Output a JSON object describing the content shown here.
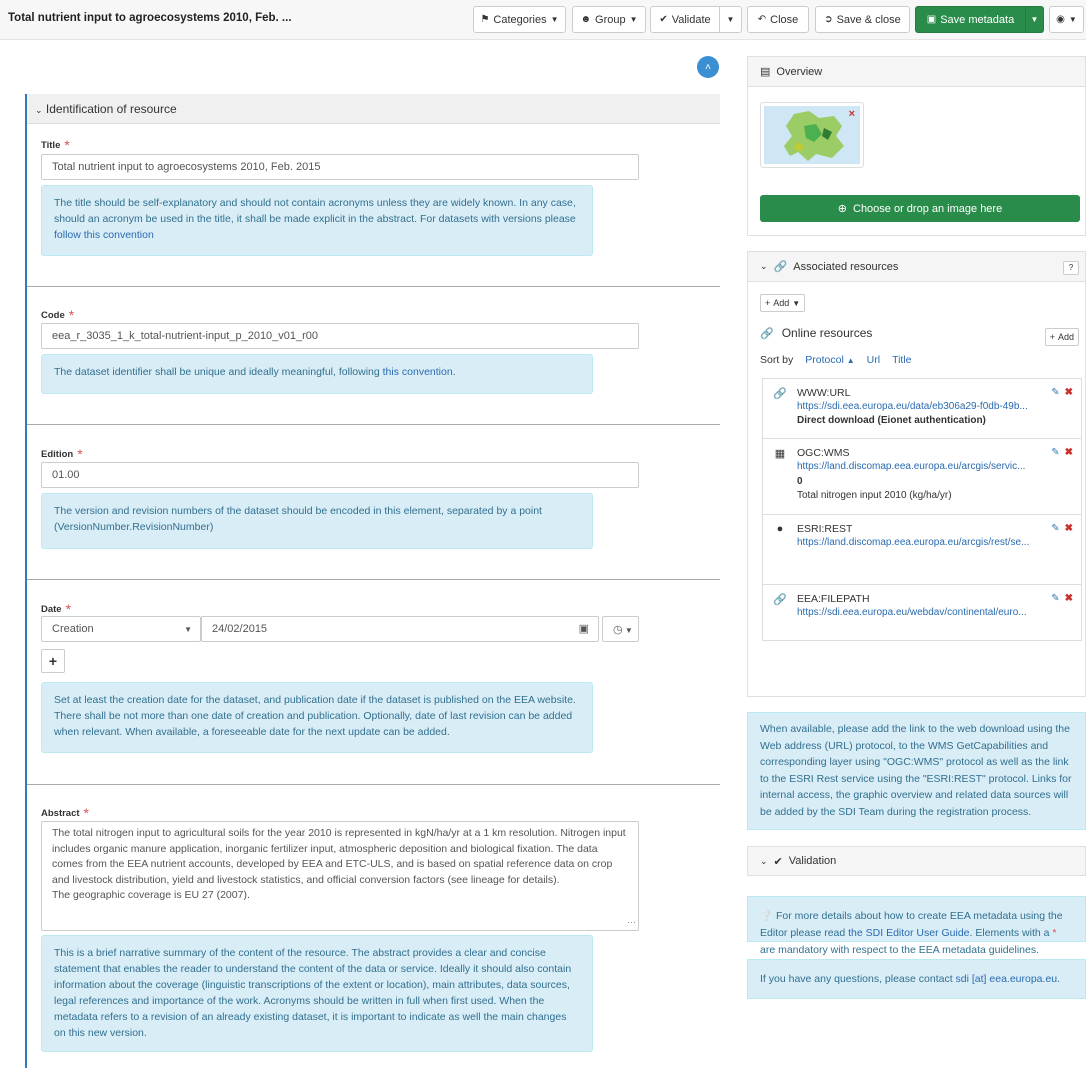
{
  "header": {
    "title": "Total nutrient input to agroecosystems 2010, Feb. ...",
    "categories_label": "Categories",
    "group_label": "Group",
    "validate_label": "Validate",
    "close_label": "Close",
    "save_close_label": "Save & close",
    "save_metadata_label": "Save metadata"
  },
  "section": {
    "title": "Identification of resource"
  },
  "title_field": {
    "label": "Title",
    "value": "Total nutrient input to agroecosystems 2010, Feb. 2015",
    "help_text": "The title should be self-explanatory and should not contain acronyms unless they are widely known. In any case, should an acronym be used in the title, it shall be made explicit in the abstract. For datasets with versions please ",
    "help_link": "follow this convention"
  },
  "code_field": {
    "label": "Code",
    "value": "eea_r_3035_1_k_total-nutrient-input_p_2010_v01_r00",
    "help_text": "The dataset identifier shall be unique and ideally meaningful, following ",
    "help_link": "this convention",
    "help_suffix": "."
  },
  "edition_field": {
    "label": "Edition",
    "value": "01.00",
    "help_text": "The version and revision numbers of the dataset should be encoded in this element, separated by a point (VersionNumber.RevisionNumber)"
  },
  "date_field": {
    "label": "Date",
    "type_value": "Creation",
    "date_value": "24/02/2015",
    "help_text": "Set at least the creation date for the dataset, and publication date if the dataset is published on the EEA website. There shall be not more than one date of creation and publication. Optionally, date of last revision can be added when relevant. When available, a foreseeable date for the next update can be added."
  },
  "abstract_field": {
    "label": "Abstract",
    "value_p1": "The total nitrogen input to agricultural soils for the year 2010 is represented in kgN/ha/yr at a 1 km resolution. Nitrogen input includes organic manure application, inorganic fertilizer input, atmospheric deposition and biological fixation. The data comes from the EEA nutrient accounts, developed by EEA and ETC-ULS, and is based on spatial reference data on crop and livestock distribution, yield and livestock statistics, and official conversion factors (see lineage for details).",
    "value_p2": "The geographic coverage is EU 27 (2007).",
    "help_text": "This is a brief narrative summary of the content of the resource. The abstract provides a clear and concise statement that enables the reader to understand the content of the data or service. Ideally it should also contain information about the coverage (linguistic transcriptions of the extent or location), main attributes, data sources, legal references and importance of the work. Acronyms should be written in full when first used. When the metadata refers to a revision of an already existing dataset, it is important to indicate as well the main changes on this new version."
  },
  "overview": {
    "title": "Overview",
    "choose_label": "Choose or drop an image here"
  },
  "associated": {
    "title": "Associated resources",
    "add_label": "Add",
    "online_title": "Online resources",
    "online_add_label": "Add",
    "sort_by": "Sort by",
    "sort_protocol": "Protocol",
    "sort_url": "Url",
    "sort_title": "Title",
    "items": [
      {
        "protocol": "WWW:URL",
        "url": "https://sdi.eea.europa.eu/data/eb306a29-f0db-49b...",
        "extra1": "Direct download (Eionet authentication)",
        "extra2": ""
      },
      {
        "protocol": "OGC:WMS",
        "url": "https://land.discomap.eea.europa.eu/arcgis/servic...",
        "extra1": "0",
        "extra2": "Total nitrogen input 2010 (kg/ha/yr)"
      },
      {
        "protocol": "ESRI:REST",
        "url": "https://land.discomap.eea.europa.eu/arcgis/rest/se...",
        "extra1": "",
        "extra2": ""
      },
      {
        "protocol": "EEA:FILEPATH",
        "url": "https://sdi.eea.europa.eu/webdav/continental/euro...",
        "extra1": "",
        "extra2": ""
      }
    ]
  },
  "resources_help": "When available, please add the link to the web download using the Web address (URL) protocol, to the WMS GetCapabilities and corresponding layer using \"OGC:WMS\" protocol as well as the link to the ESRI Rest service using the \"ESRI:REST\" protocol. Links for internal access, the graphic overview and related data sources will be added by the SDI Team during the registration process.",
  "validation": {
    "title": "Validation"
  },
  "guide_help": {
    "prefix": "For more details about how to create EEA metadata using the Editor please read ",
    "link": "the SDI Editor User Guide",
    "suffix": ". Elements with a ",
    "star": "*",
    "end": " are mandatory with respect to the EEA metadata guidelines."
  },
  "contact_help": {
    "prefix": "If you have any questions, please contact ",
    "link": "sdi [at] eea.europa.eu",
    "suffix": "."
  }
}
